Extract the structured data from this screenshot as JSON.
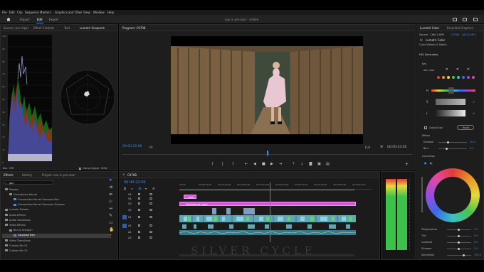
{
  "menu": [
    "File",
    "Edit",
    "Clip",
    "Sequence",
    "Markers",
    "Graphics and Titles",
    "View",
    "Window",
    "Help"
  ],
  "header": {
    "workspaces": [
      "Import",
      "Edit",
      "Export"
    ],
    "active_workspace": "Edit",
    "doc_title": "ooo in pre-ooo! - Edited"
  },
  "source_panel": {
    "tabs": [
      "Source: (no clips)",
      "Effect Controls",
      "Text",
      "Lumetri Scopes"
    ],
    "active_tab": "Lumetri Scopes",
    "scale_labels": [
      "100",
      "90",
      "80",
      "70",
      "60",
      "50",
      "40",
      "30",
      "20",
      "10",
      "0"
    ],
    "clamp_label": "Clamp Signal",
    "bit_depth": "8 Bit",
    "footer_left": "Rec. 709"
  },
  "program_panel": {
    "title": "Program: C9708",
    "timecode": "00:00:22:06",
    "fit": "Fit",
    "quality": "Full",
    "duration": "00:00:43:05"
  },
  "effects_panel": {
    "tabs": [
      "Effects",
      "History",
      "Project: ooo in pre-ooo!"
    ],
    "search_value": "gau",
    "tree": [
      {
        "label": "Presets",
        "indent": 0,
        "folder": true
      },
      {
        "label": "Convolution Kernel",
        "indent": 1,
        "folder": true
      },
      {
        "label": "Convolution Kernel Gaussian Blur",
        "indent": 2,
        "folder": false
      },
      {
        "label": "Convolution Kernel Gaussian Sharpen",
        "indent": 2,
        "folder": false
      },
      {
        "label": "Lumetri Presets",
        "indent": 0,
        "folder": true
      },
      {
        "label": "Audio Effects",
        "indent": 0,
        "folder": true
      },
      {
        "label": "Audio Transitions",
        "indent": 0,
        "folder": true
      },
      {
        "label": "Video Effects",
        "indent": 0,
        "folder": true
      },
      {
        "label": "Blur & Sharpen",
        "indent": 1,
        "folder": true
      },
      {
        "label": "Gaussian Blur",
        "indent": 2,
        "folder": false,
        "selected": true
      },
      {
        "label": "Video Transitions",
        "indent": 0,
        "folder": true
      },
      {
        "label": "Custom Bin 01",
        "indent": 0,
        "folder": true
      },
      {
        "label": "Custom Bin 02",
        "indent": 0,
        "folder": true
      }
    ]
  },
  "timeline": {
    "tab": "C9708",
    "timecode": "00:00:22:06",
    "ruler_labels": [
      "00:00",
      "00:00:05:00",
      "00:00:10:00",
      "00:00:15:00",
      "00:00:20:00",
      "00:00:25:00",
      "00:00:30:00",
      "00:00:35:00",
      "00:00:40:00",
      "00:00:45:00"
    ],
    "tracks": [
      "V5",
      "V4",
      "V3",
      "V2",
      "V1",
      "A1",
      "A2",
      "A3"
    ],
    "clips": [
      {
        "label": "text",
        "color": "#d35ad6"
      },
      {
        "label": "Adjustment Layer",
        "color": "#d35ad6"
      }
    ],
    "watermark": "SILVER CYCLE"
  },
  "lumetri_color": {
    "tabs": [
      "Lumetri Color",
      "Essential Graphics"
    ],
    "source": "Source · C8011.MP4",
    "target": "C9708 · C8011.MP4",
    "fx_label": "fx",
    "effect_name": "Lumetri Color",
    "match_label": "Color Wheels & Match",
    "hsl_label": "HSL Secondary",
    "key_label": "Key",
    "set_color_label": "Set color",
    "channels": [
      "H",
      "S",
      "L"
    ],
    "color_gray_label": "Color/Gray",
    "reset_label": "Reset",
    "refine_label": "Refine",
    "denoise_label": "Denoise",
    "denoise_value": "10.0",
    "blur_label": "Blur",
    "blur_value": "0.0",
    "correction_label": "Correction",
    "sliders": [
      {
        "label": "Temperature",
        "value": "0.0"
      },
      {
        "label": "Tint",
        "value": "0.0"
      },
      {
        "label": "Contrast",
        "value": "0.0"
      },
      {
        "label": "Sharpen",
        "value": "0.0"
      },
      {
        "label": "Saturation",
        "value": "100.0"
      }
    ],
    "swatches": [
      "#e23a3a",
      "#e8932a",
      "#e7d83a",
      "#4bc24b",
      "#3ac1c4",
      "#3a6be6",
      "#9a4ae0",
      "#e04aa7"
    ]
  },
  "colors": {
    "accent": "#3a8bf0",
    "clip_pink": "#d35ad6",
    "clip_teal": "#5fa6b8"
  }
}
